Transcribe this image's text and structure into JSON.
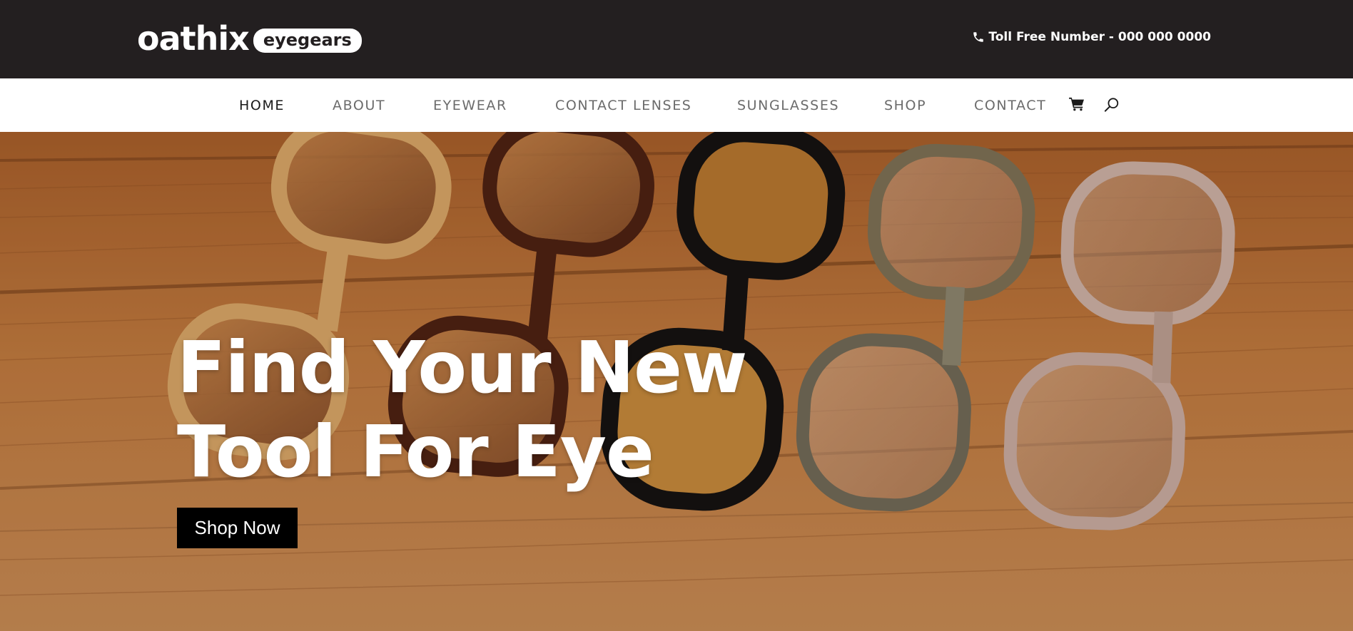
{
  "header": {
    "logo_main": "oathix",
    "logo_pill": "eyegears",
    "phone_text": "Toll Free Number - 000 000 0000"
  },
  "nav": {
    "items": [
      {
        "label": "HOME",
        "active": true
      },
      {
        "label": "ABOUT"
      },
      {
        "label": "EYEWEAR"
      },
      {
        "label": "CONTACT LENSES"
      },
      {
        "label": "SUNGLASSES"
      },
      {
        "label": "SHOP"
      },
      {
        "label": "CONTACT"
      }
    ],
    "icons": [
      "cart-icon",
      "search-icon"
    ]
  },
  "hero": {
    "title_line1": "Find Your New",
    "title_line2": "Tool For Eye",
    "cta_label": "Shop Now",
    "image": "eyeglasses-on-wooden-table"
  },
  "colors": {
    "topbar": "#231f20",
    "nav_bg": "#ffffff",
    "nav_text": "#6b6b6b",
    "nav_active": "#1a1a1a",
    "cta_bg": "#000000",
    "wood": "#b9743a"
  }
}
